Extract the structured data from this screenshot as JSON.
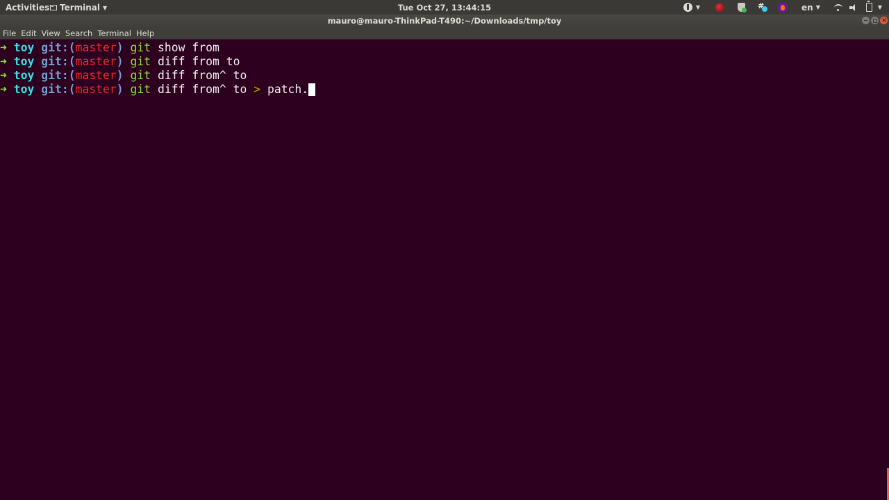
{
  "topbar": {
    "activities": "Activities",
    "app_menu": "Terminal",
    "clock": "Tue Oct 27, 13:44:15",
    "tray": {
      "language": "en",
      "icons": [
        "accessibility-icon",
        "recorder-icon",
        "shield-icon",
        "slack-icon",
        "app-flame-icon",
        "wifi-icon",
        "volume-icon",
        "battery-icon"
      ]
    }
  },
  "window": {
    "title": "mauro@mauro-ThinkPad-T490:~/Downloads/tmp/toy",
    "buttons": [
      "minimize",
      "maximize",
      "close"
    ]
  },
  "menubar": {
    "items": [
      "File",
      "Edit",
      "View",
      "Search",
      "Terminal",
      "Help"
    ]
  },
  "terminal": {
    "lines": [
      {
        "arrow": "➜",
        "dir": "toy",
        "git_label": "git:(",
        "branch": "master",
        "git_close": ")",
        "cmd": "git",
        "args": "show from",
        "redir": "",
        "tail": ""
      },
      {
        "arrow": "➜",
        "dir": "toy",
        "git_label": "git:(",
        "branch": "master",
        "git_close": ")",
        "cmd": "git",
        "args": "diff from to",
        "redir": "",
        "tail": ""
      },
      {
        "arrow": "➜",
        "dir": "toy",
        "git_label": "git:(",
        "branch": "master",
        "git_close": ")",
        "cmd": "git",
        "args": "diff from^ to",
        "redir": "",
        "tail": ""
      },
      {
        "arrow": "➜",
        "dir": "toy",
        "git_label": "git:(",
        "branch": "master",
        "git_close": ")",
        "cmd": "git",
        "args": "diff from^ to",
        "redir": ">",
        "tail": "patch."
      }
    ]
  },
  "colors": {
    "terminal_bg": "#2c001e",
    "arrow": "#8ae234",
    "dir": "#34e2e2",
    "git_label": "#729fcf",
    "branch": "#ef2929",
    "command": "#8ae234",
    "redirect": "#c4a000"
  }
}
